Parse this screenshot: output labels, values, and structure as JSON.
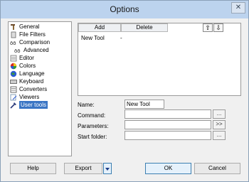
{
  "window": {
    "title": "Options",
    "close_glyph": "✕"
  },
  "tree": [
    {
      "label": "General",
      "icon": "hammer-icon",
      "color": "#6b4a2a"
    },
    {
      "label": "File Filters",
      "icon": "file-filter-icon",
      "color": "#6b6b6b"
    },
    {
      "label": "Comparison",
      "icon": "comparison-icon",
      "color": "#2a2a2a"
    },
    {
      "label": "Advanced",
      "icon": "advanced-comparison-icon",
      "color": "#2a2a2a",
      "indent": true
    },
    {
      "label": "Editor",
      "icon": "editor-icon",
      "color": "#7a7a7a"
    },
    {
      "label": "Colors",
      "icon": "colors-icon",
      "color": "#d42a2a"
    },
    {
      "label": "Language",
      "icon": "language-icon",
      "color": "#2a5ad4"
    },
    {
      "label": "Keyboard",
      "icon": "keyboard-icon",
      "color": "#555555"
    },
    {
      "label": "Converters",
      "icon": "converters-icon",
      "color": "#444444"
    },
    {
      "label": "Viewers",
      "icon": "viewers-icon",
      "color": "#6a8aa8"
    },
    {
      "label": "User tools",
      "icon": "user-tools-icon",
      "color": "#2a3a7a",
      "selected": true
    }
  ],
  "list_header": {
    "add": "Add",
    "delete": "Delete",
    "up": "⇧",
    "down": "⇩"
  },
  "tools": [
    {
      "name": "New Tool",
      "value": "-"
    }
  ],
  "form": {
    "name_label": "Name:",
    "name_value": "New Tool",
    "command_label": "Command:",
    "command_value": "",
    "parameters_label": "Parameters:",
    "parameters_value": "",
    "start_folder_label": "Start folder:",
    "start_folder_value": "",
    "dots": "...",
    "insert": ">>"
  },
  "buttons": {
    "help": "Help",
    "export": "Export",
    "ok": "OK",
    "cancel": "Cancel"
  },
  "colors": {
    "selection": "#3a75c4",
    "title_bar": "#bcd3ee"
  }
}
